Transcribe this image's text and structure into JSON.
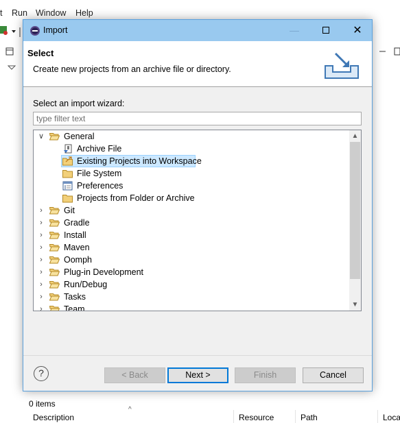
{
  "menubar": {
    "items": [
      "t",
      "Run",
      "Window",
      "Help"
    ]
  },
  "dialog": {
    "title": "Import",
    "header": {
      "title": "Select",
      "description": "Create new projects from an archive file or directory."
    },
    "wizard_label": "Select an import wizard:",
    "filter": {
      "placeholder": "type filter text",
      "value": ""
    },
    "tree": {
      "general": {
        "label": "General",
        "children": [
          {
            "label": "Archive File",
            "icon": "archive-file-icon"
          },
          {
            "label": "Existing Projects into Workspace",
            "icon": "folder-project-icon",
            "selected": true
          },
          {
            "label": "File System",
            "icon": "folder-icon"
          },
          {
            "label": "Preferences",
            "icon": "preferences-icon"
          },
          {
            "label": "Projects from Folder or Archive",
            "icon": "folder-icon"
          }
        ]
      },
      "categories": [
        "Git",
        "Gradle",
        "Install",
        "Maven",
        "Oomph",
        "Plug-in Development",
        "Run/Debug",
        "Tasks",
        "Team"
      ]
    },
    "buttons": {
      "help": "?",
      "back": "< Back",
      "next": "Next >",
      "finish": "Finish",
      "cancel": "Cancel"
    }
  },
  "bottom_panel": {
    "items_count": "0 items",
    "columns": [
      "Description",
      "Resource",
      "Path",
      "Loca"
    ]
  },
  "colors": {
    "titlebar": "#99c9ef",
    "selection": "#cce8ff",
    "default_button_border": "#0078d7"
  }
}
